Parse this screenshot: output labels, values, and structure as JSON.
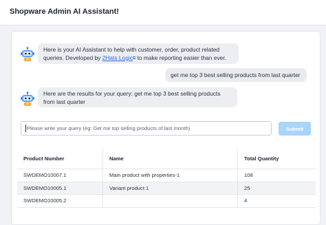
{
  "header": {
    "title": "Shopware Admin AI Assistant!"
  },
  "chat": {
    "assistant_intro": {
      "text_before_link": "Here is your AI Assistant to help with customer, order, product related queries. Developed by ",
      "link_text": "2Hats Logic",
      "text_after_link": " to make reporting easier than ever."
    },
    "user_query": "get me top 3 best selling products from last quarter",
    "assistant_result": "Here are the results for your query: get me top 3 best selling products from last quarter"
  },
  "input": {
    "placeholder": "Please write your query (eg: Get me top selling products of last month)",
    "value": ""
  },
  "submit_label": "Submit",
  "table": {
    "headers": [
      "Product Number",
      "Name",
      "Total Quantity"
    ],
    "rows": [
      [
        "SWDEMO10007.1",
        "Main product with properties-1",
        "108"
      ],
      [
        "SWDEMO10005.1",
        "Variant product 1",
        "25"
      ],
      [
        "SWDEMO10005.2",
        "",
        "4"
      ]
    ]
  }
}
